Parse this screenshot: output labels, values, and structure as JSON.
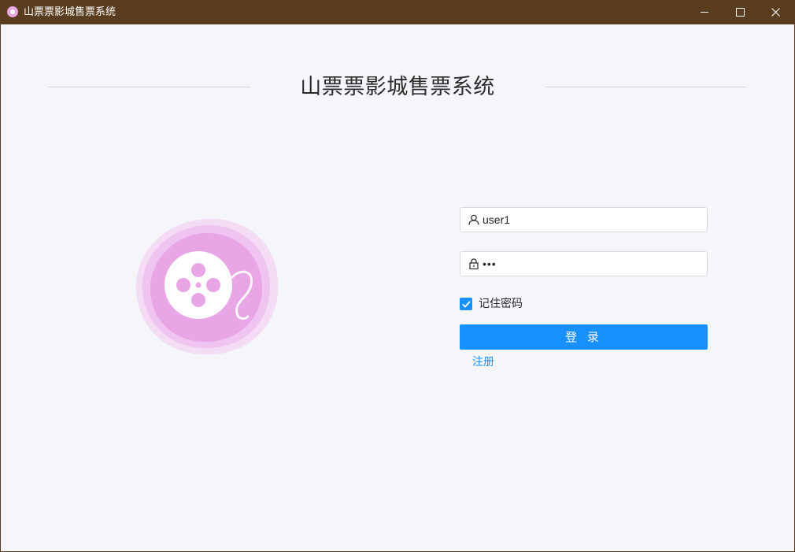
{
  "window": {
    "title": "山票票影城售票系统"
  },
  "page": {
    "title": "山票票影城售票系统"
  },
  "login_form": {
    "username_value": "user1",
    "password_value": "•••",
    "remember_label": "记住密码",
    "remember_checked": true,
    "login_label": "登 录",
    "register_label": "注册"
  },
  "icons": {
    "app": "film-reel-icon",
    "logo": "film-reel-logo",
    "username": "user-icon",
    "password": "lock-icon",
    "checkbox": "check-icon",
    "minimize": "minimize-icon",
    "maximize": "maximize-icon",
    "close": "close-icon"
  },
  "colors": {
    "titlebar": "#5a3d1e",
    "background": "#f4f6fa",
    "accent": "#1890ff",
    "logo_pink": "#e9a6e6"
  }
}
